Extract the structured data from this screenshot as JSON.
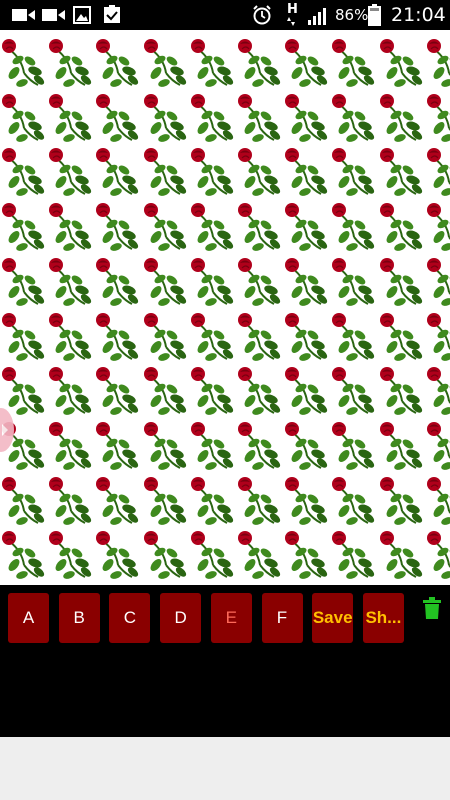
{
  "status_bar": {
    "network": "H",
    "battery": "86%",
    "time": "21:04",
    "icons": [
      "video-icon",
      "video-icon",
      "image-icon",
      "clipboard-check-icon",
      "alarm-icon",
      "network-h-icon",
      "signal-icon",
      "battery-icon"
    ]
  },
  "pattern": {
    "tile": "rose-icon",
    "colors": {
      "petal": "#b0001b",
      "petal_dark": "#7a0010",
      "leaf": "#3f8a1e",
      "leaf_dark": "#2a6512"
    }
  },
  "toolbar": {
    "buttons": [
      {
        "label": "A",
        "style": "normal"
      },
      {
        "label": "B",
        "style": "normal"
      },
      {
        "label": "C",
        "style": "normal"
      },
      {
        "label": "D",
        "style": "normal"
      },
      {
        "label": "E",
        "style": "dim"
      },
      {
        "label": "F",
        "style": "normal"
      },
      {
        "label": "Save",
        "style": "gold"
      },
      {
        "label": "Sh...",
        "style": "gold"
      }
    ],
    "trash_icon": "trash-icon",
    "colors": {
      "button_bg": "#8a0000",
      "accent": "#ffc000",
      "trash": "#22c322"
    }
  }
}
